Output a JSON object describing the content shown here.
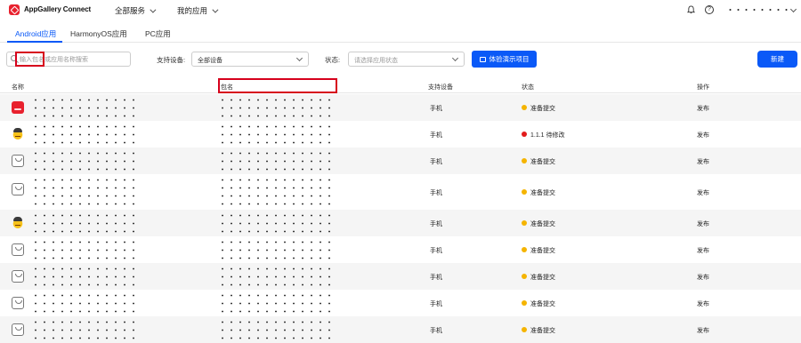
{
  "header": {
    "brand": "AppGallery Connect",
    "nav": [
      "全部服务",
      "我的应用"
    ],
    "help": "?"
  },
  "tabs": [
    "Android应用",
    "HarmonyOS应用",
    "PC应用"
  ],
  "filters": {
    "search_placeholder": "输入包名或应用名称搜索",
    "device_label": "支持设备:",
    "device_value": "全部设备",
    "status_label": "状态:",
    "status_placeholder": "请选择应用状态",
    "demo_button": "体验演示项目",
    "new_button": "新建"
  },
  "table": {
    "columns": [
      "名称",
      "包名",
      "支持设备",
      "状态",
      "操作"
    ],
    "rows": [
      {
        "icon": "red-app-icon",
        "device": "手机",
        "status": "准备提交",
        "status_color": "#f5b400",
        "action": "发布"
      },
      {
        "icon": "emoji-app-icon",
        "device": "手机",
        "status": "1.1.1 待修改",
        "status_color": "#e21b1b",
        "action": "发布"
      },
      {
        "icon": "generic-app-icon",
        "device": "手机",
        "status": "准备提交",
        "status_color": "#f5b400",
        "action": "发布"
      },
      {
        "icon": "generic-app-icon",
        "device": "手机",
        "status": "准备提交",
        "status_color": "#f5b400",
        "action": "发布"
      },
      {
        "icon": "emoji-app-icon",
        "device": "手机",
        "status": "准备提交",
        "status_color": "#f5b400",
        "action": "发布"
      },
      {
        "icon": "generic-app-icon",
        "device": "手机",
        "status": "准备提交",
        "status_color": "#f5b400",
        "action": "发布"
      },
      {
        "icon": "generic-app-icon",
        "device": "手机",
        "status": "准备提交",
        "status_color": "#f5b400",
        "action": "发布"
      },
      {
        "icon": "generic-app-icon",
        "device": "手机",
        "status": "准备提交",
        "status_color": "#f5b400",
        "action": "发布"
      },
      {
        "icon": "generic-app-icon",
        "device": "手机",
        "status": "准备提交",
        "status_color": "#f5b400",
        "action": "发布"
      }
    ]
  },
  "colors": {
    "accent": "#0a59f7",
    "highlight": "#d6001c"
  }
}
